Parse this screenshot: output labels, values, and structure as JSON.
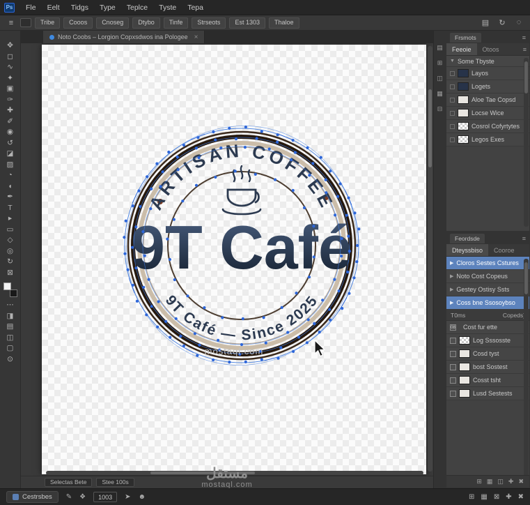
{
  "colors": {
    "selection_blue": "#5d83bd",
    "vector_blue": "#2d66d9",
    "ring_brown": "#26190e",
    "band_tan": "#cbbda9",
    "text_navy": "#2c3a50"
  },
  "menu_bar": {
    "app_icon": "Ps",
    "items": [
      "Fle",
      "Eelt",
      "Tidgs",
      "Type",
      "Teplce",
      "Tyste",
      "Tepa"
    ]
  },
  "options_bar": {
    "menu_icon": "≡",
    "buttons": [
      "Tribe",
      "Cooos",
      "Cnoseg",
      "Dtybo",
      "Tinfe"
    ],
    "extras": [
      "Strseots",
      "Est 1303",
      "Thaloe"
    ],
    "right_icons": [
      "▤",
      "↻",
      "◌"
    ]
  },
  "document_tab": {
    "title": "Noto Coobs – Lorgion Copxsdwos ina Pologee",
    "close": "×"
  },
  "tool_palette": {
    "tools": [
      {
        "name": "move-tool",
        "glyph": "✥"
      },
      {
        "name": "marquee-tool",
        "glyph": "◻"
      },
      {
        "name": "lasso-tool",
        "glyph": "∿"
      },
      {
        "name": "wand-tool",
        "glyph": "✦"
      },
      {
        "name": "crop-tool",
        "glyph": "▣"
      },
      {
        "name": "eyedropper-tool",
        "glyph": "✑"
      },
      {
        "name": "heal-tool",
        "glyph": "✚"
      },
      {
        "name": "brush-tool",
        "glyph": "✐"
      },
      {
        "name": "stamp-tool",
        "glyph": "◉"
      },
      {
        "name": "history-brush-tool",
        "glyph": "↺"
      },
      {
        "name": "eraser-tool",
        "glyph": "◪"
      },
      {
        "name": "gradient-tool",
        "glyph": "▨"
      },
      {
        "name": "blur-tool",
        "glyph": "◔"
      },
      {
        "name": "dodge-tool",
        "glyph": "◖"
      },
      {
        "name": "pen-tool",
        "glyph": "✒"
      },
      {
        "name": "type-tool",
        "glyph": "T"
      },
      {
        "name": "path-select-tool",
        "glyph": "▸"
      },
      {
        "name": "shape-tool",
        "glyph": "▭"
      },
      {
        "name": "hand-tool",
        "glyph": "◇"
      },
      {
        "name": "zoom-tool",
        "glyph": "◎"
      },
      {
        "name": "rotate-view-tool",
        "glyph": "↻"
      },
      {
        "name": "frame-tool",
        "glyph": "⊠"
      }
    ],
    "bottom_tools": [
      {
        "name": "edit-toolbar",
        "glyph": "⋯"
      },
      {
        "name": "quick-mask",
        "glyph": "◨"
      },
      {
        "name": "screen-mode",
        "glyph": "▤"
      },
      {
        "name": "artboard-tool",
        "glyph": "◫"
      },
      {
        "name": "extra-tool-1",
        "glyph": "▢"
      },
      {
        "name": "extra-tool-2",
        "glyph": "⊙"
      }
    ]
  },
  "dock_strip": {
    "icons": [
      "▤",
      "⊞",
      "◫",
      "▦",
      "⊟"
    ]
  },
  "layers_panel": {
    "header": "Frsmots",
    "menu_icon": "≡",
    "tabs": [
      "Feeoie",
      "Otoos"
    ],
    "group_label": "Some Tbyste",
    "rows": [
      {
        "label": "Layos",
        "thumb": "dark"
      },
      {
        "label": "Logets",
        "thumb": "dark"
      },
      {
        "label": "Aloe Tae Copsd",
        "thumb": "light"
      },
      {
        "label": "Locse Wice",
        "thumb": "light"
      },
      {
        "label": "Cosrol Cofyrtytes",
        "thumb": "checker"
      },
      {
        "label": "Legos Exes",
        "thumb": "checker"
      }
    ]
  },
  "properties_panel": {
    "header": "Feordsde",
    "menu_icon": "≡",
    "tabs": [
      "Dteyssbiso",
      "Cooroe"
    ],
    "groups": [
      {
        "label": "Cloros Sestes Cstures",
        "selected": true
      },
      {
        "label": "Noto Cost Copeus",
        "selected": false
      },
      {
        "label": "Gestey Ostisy Ssts",
        "selected": false
      },
      {
        "label": "Coss bne Ssosoybso",
        "selected": true
      }
    ],
    "sublist": {
      "left": "T0ms",
      "right": "Copeds)"
    },
    "items": [
      {
        "check": "08",
        "label": "Cost fur ette",
        "thumb": "none"
      },
      {
        "check": "",
        "label": "Log Sssosste",
        "thumb": "checker"
      },
      {
        "check": "",
        "label": "Cosd tyst",
        "thumb": "light"
      },
      {
        "check": "",
        "label": "bost Sostest",
        "thumb": "light"
      },
      {
        "check": "",
        "label": "Cosst tsht",
        "thumb": "light"
      },
      {
        "check": "",
        "label": "Lusd Sestests",
        "thumb": "light"
      }
    ],
    "footer_icons": [
      "⊞",
      "▦",
      "◫",
      "✚",
      "✖"
    ]
  },
  "logo": {
    "arc_top": "ARTISAN COFFEE",
    "title": "9T Café",
    "arc_bottom": "9T Café — Since 2025"
  },
  "status_strip": {
    "buttons": [
      "Selectas Bete",
      "Stee 100s"
    ]
  },
  "bottom_bar": {
    "left_button": "Cestrsbes",
    "pen_icon": "✎",
    "shape_icon": "❖",
    "zoom_value": "1003",
    "nav_icon": "➤",
    "users_icon": "☻",
    "right_icons": [
      "⊞",
      "▦",
      "⊠",
      "✚",
      "✖"
    ]
  },
  "watermark": {
    "canvas_text": "mostaql.com",
    "arabic": "مستقل",
    "domain": "mostaql.com"
  }
}
